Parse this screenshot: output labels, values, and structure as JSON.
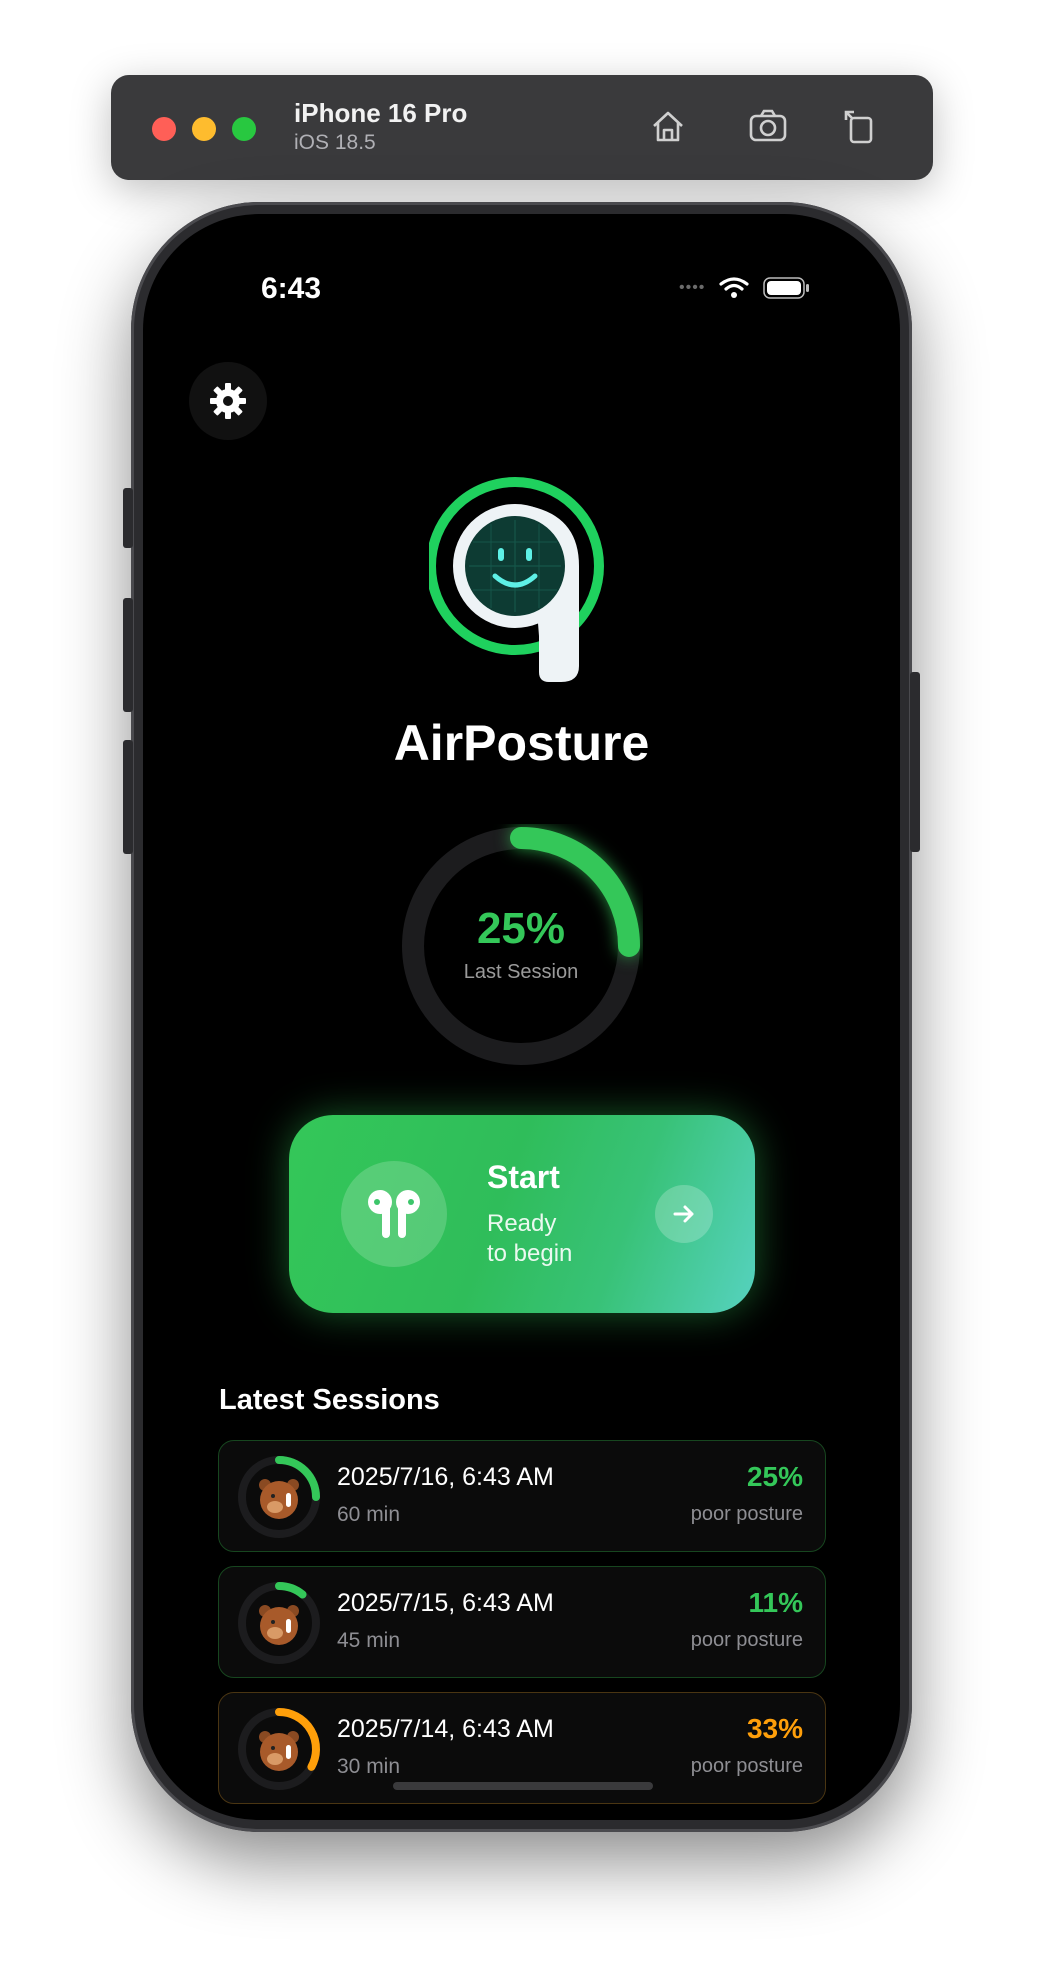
{
  "simulator": {
    "device_name": "iPhone 16 Pro",
    "os_version": "iOS 18.5"
  },
  "status_bar": {
    "time": "6:43",
    "signal": "••••"
  },
  "app": {
    "title": "AirPosture"
  },
  "progress_ring": {
    "value_text": "25%",
    "value_fraction": 0.25,
    "label": "Last Session",
    "color": "#34c759"
  },
  "start_card": {
    "title": "Start",
    "subtitle_line1": "Ready",
    "subtitle_line2": "to begin",
    "icon": "airpods-icon",
    "arrow_icon": "arrow-right-icon"
  },
  "sessions_section": {
    "title": "Latest Sessions"
  },
  "sessions": [
    {
      "date": "2025/7/16, 6:43 AM",
      "duration": "60 min",
      "percent": "25%",
      "fraction": 0.25,
      "label": "poor posture",
      "color": "#34c759"
    },
    {
      "date": "2025/7/15, 6:43 AM",
      "duration": "45 min",
      "percent": "11%",
      "fraction": 0.11,
      "label": "poor posture",
      "color": "#34c759"
    },
    {
      "date": "2025/7/14, 6:43 AM",
      "duration": "30 min",
      "percent": "33%",
      "fraction": 0.33,
      "label": "poor posture",
      "color": "#ff9f0a"
    }
  ],
  "colors": {
    "accent_green": "#34c759",
    "warning_orange": "#ff9f0a",
    "background": "#000000"
  }
}
